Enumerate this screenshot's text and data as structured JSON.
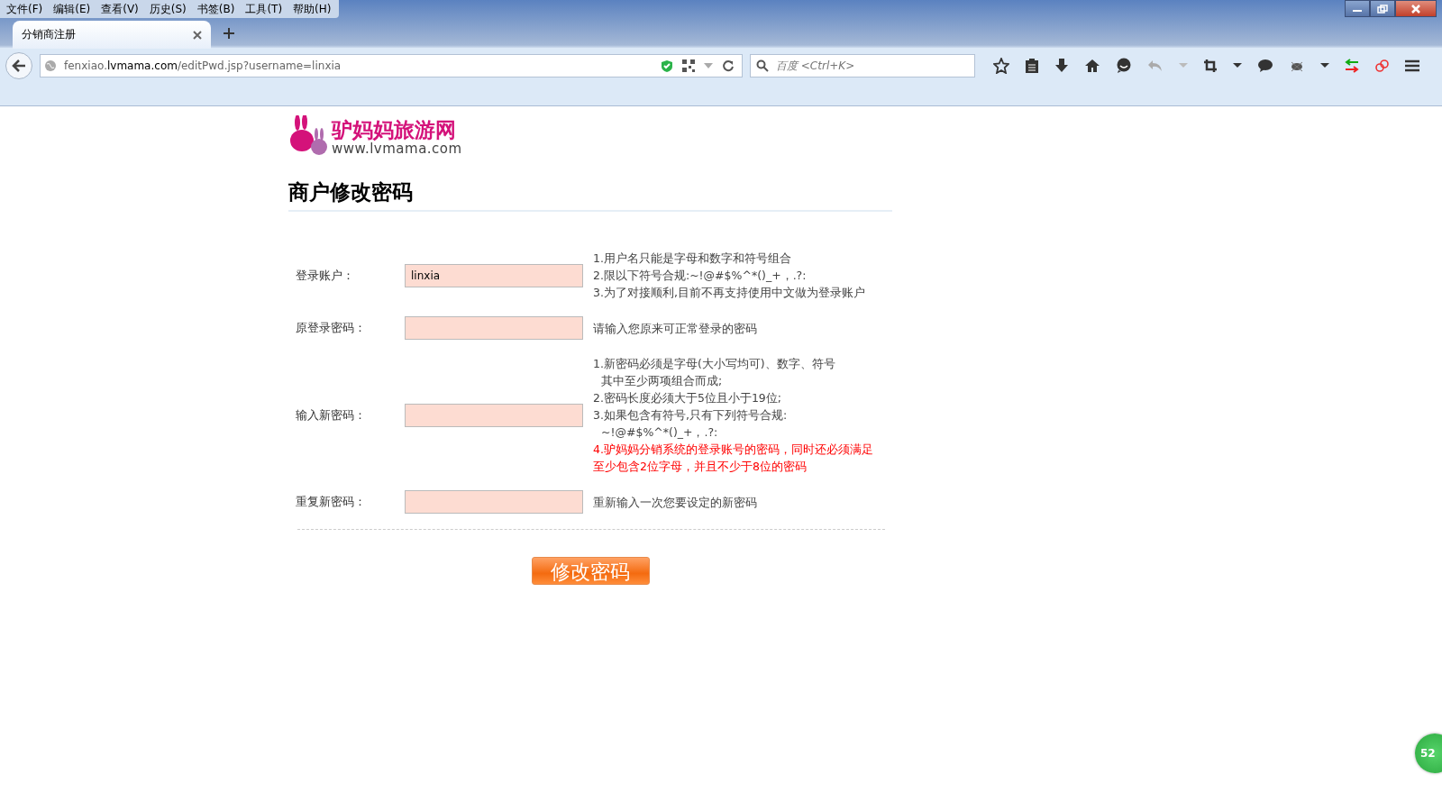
{
  "menu_bar": [
    "文件(F)",
    "编辑(E)",
    "查看(V)",
    "历史(S)",
    "书签(B)",
    "工具(T)",
    "帮助(H)"
  ],
  "tabs": [
    {
      "label": "分销商注册",
      "selected": true
    }
  ],
  "address_bar": {
    "host_prefix": "fenxiao.",
    "host_domain": "lvmama.com",
    "path": "/editPwd.jsp?username=linxia"
  },
  "search": {
    "placeholder": "百度 <Ctrl+K>"
  },
  "logo": {
    "name": "驴妈妈旅游网",
    "url": "www.lvmama.com"
  },
  "heading": "商户修改密码",
  "form_rows": [
    {
      "label": "登录账户：",
      "value": "linxia",
      "hints": [
        {
          "kind": "line",
          "text": "1.用户名只能是字母和数字和符号组合"
        },
        {
          "kind": "line",
          "text": "2.限以下符号合规:~!@#$%^*()_+，.?:"
        },
        {
          "kind": "line",
          "text": "3.为了对接顺利,目前不再支持使用中文做为登录账户"
        }
      ]
    },
    {
      "label": "原登录密码：",
      "hints": [
        {
          "kind": "line",
          "text": "请输入您原来可正常登录的密码"
        }
      ]
    },
    {
      "label": "输入新密码：",
      "hints": [
        {
          "kind": "line",
          "text": "1.新密码必须是字母(大小写均可)、数字、符号"
        },
        {
          "kind": "continuation",
          "text": "其中至少两项组合而成;"
        },
        {
          "kind": "line",
          "text": "2.密码长度必须大于5位且小于19位;"
        },
        {
          "kind": "line",
          "text": "3.如果包含有符号,只有下列符号合规:"
        },
        {
          "kind": "continuation",
          "text": "~!@#$%^*()_+，.?:"
        },
        {
          "kind": "warning",
          "text": "4.驴妈妈分销系统的登录账号的密码，同时还必须满足至少包含2位字母，并且不少于8位的密码"
        }
      ]
    },
    {
      "label": "重复新密码：",
      "hints": [
        {
          "kind": "line",
          "text": "重新输入一次您要设定的新密码"
        }
      ]
    }
  ],
  "submit_button": "修改密码",
  "floating_badge": "52"
}
